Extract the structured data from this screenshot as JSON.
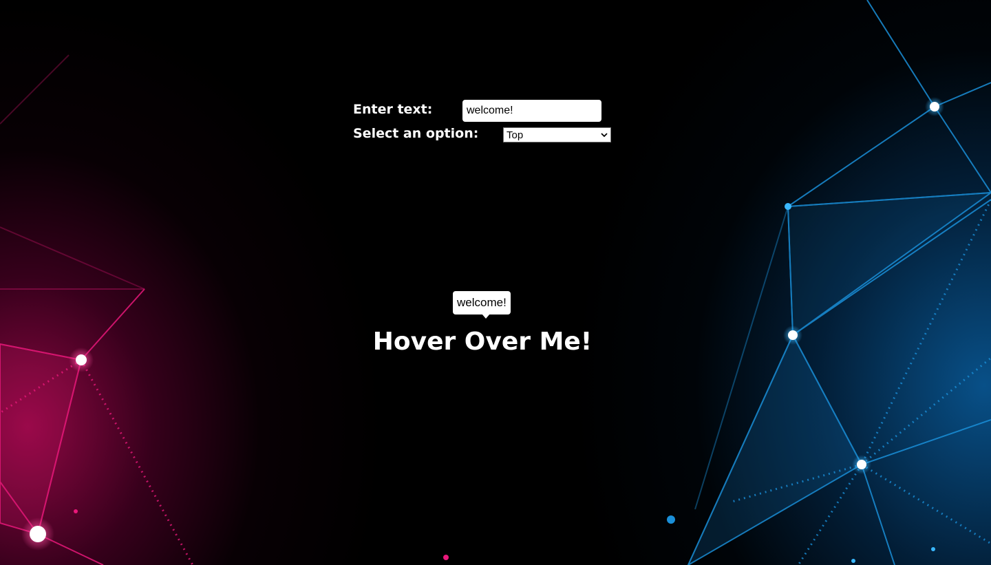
{
  "form": {
    "text_label": "Enter text:",
    "text_value": "welcome!",
    "select_label": "Select an option:",
    "select_value": "Top"
  },
  "tooltip": {
    "text": "welcome!"
  },
  "hover_target": {
    "text": "Hover Over Me!"
  },
  "colors": {
    "left_glow": "#e0186e",
    "right_glow": "#1a8fd8",
    "text": "#ffffff"
  }
}
